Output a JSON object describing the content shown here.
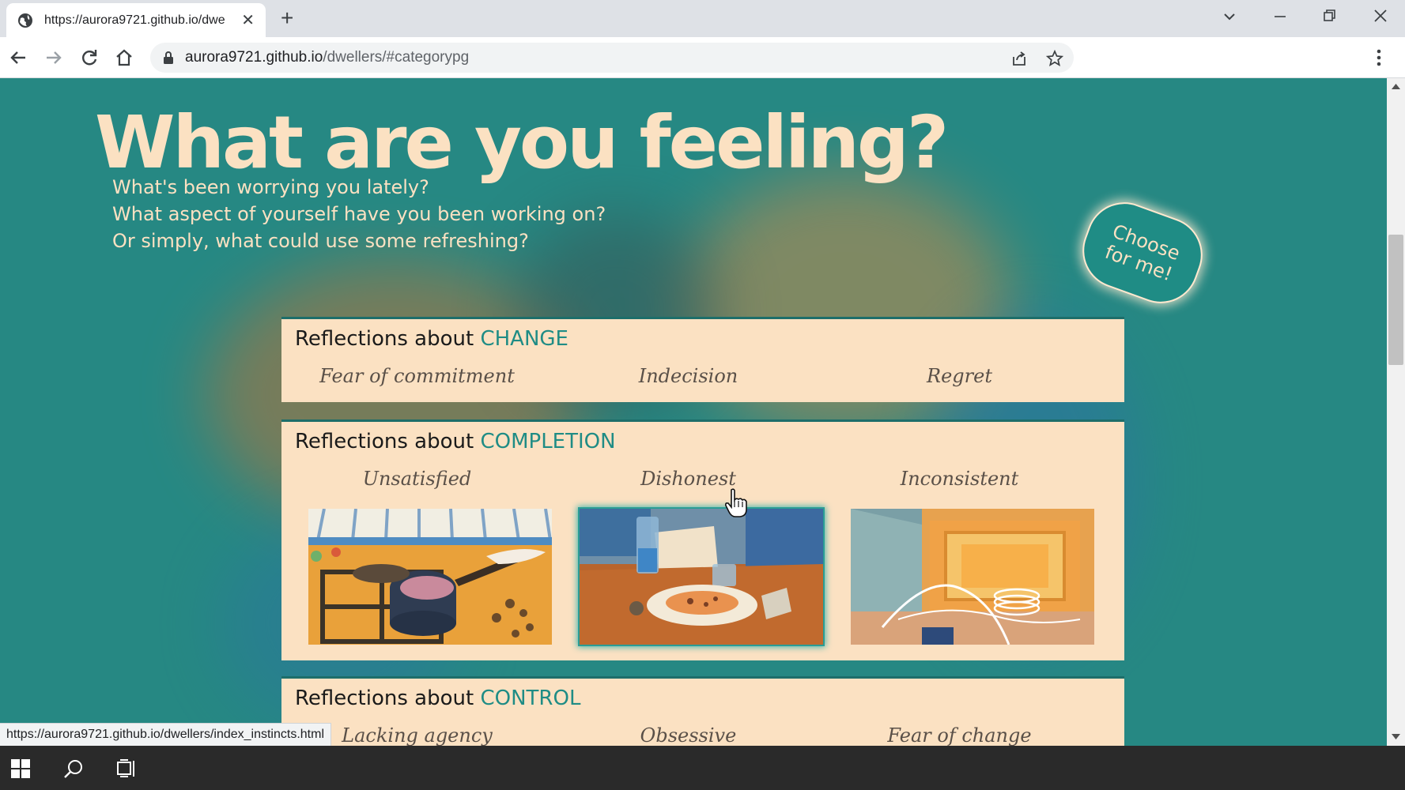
{
  "browser": {
    "tab_title": "https://aurora9721.github.io/dwe",
    "url_host": "aurora9721.github.io",
    "url_path": "/dwellers/#categorypg",
    "status_url": "https://aurora9721.github.io/dwellers/index_instincts.html"
  },
  "page": {
    "title": "What are you feeling?",
    "subtitle_lines": [
      "What's been worrying you lately?",
      "What aspect of yourself have you been working on?",
      "Or simply, what could use some refreshing?"
    ],
    "choose_button": "Choose for me!",
    "categories": [
      {
        "prefix": "Reflections about ",
        "name": "CHANGE",
        "options": [
          "Fear of commitment",
          "Indecision",
          "Regret"
        ]
      },
      {
        "prefix": "Reflections about ",
        "name": "COMPLETION",
        "options": [
          "Unsatisfied",
          "Dishonest",
          "Inconsistent"
        ]
      },
      {
        "prefix": "Reflections about ",
        "name": "CONTROL",
        "options": [
          "Lacking agency",
          "Obsessive",
          "Fear of change"
        ]
      }
    ]
  },
  "colors": {
    "page_bg": "#268883",
    "cream": "#fbe1c2",
    "accent": "#1f8c85"
  }
}
